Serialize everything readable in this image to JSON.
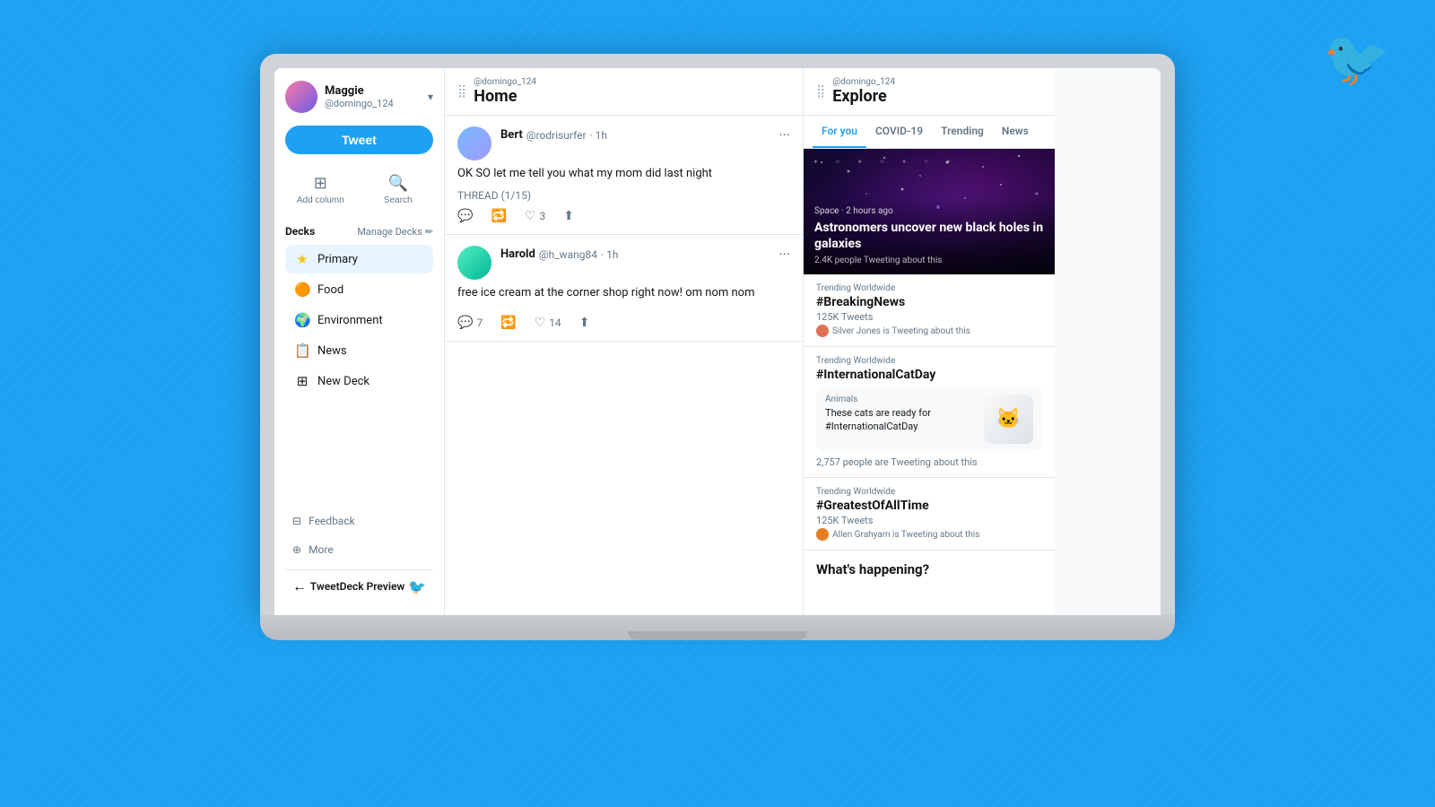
{
  "background": {
    "color": "#1DA1F2"
  },
  "twitter_icon": "🐦",
  "sidebar": {
    "user": {
      "name": "Maggie",
      "handle": "@domingo_124"
    },
    "tweet_button": "Tweet",
    "actions": [
      {
        "id": "add-column",
        "label": "Add column",
        "icon": "⊞"
      },
      {
        "id": "search",
        "label": "Search",
        "icon": "🔍"
      }
    ],
    "decks_title": "Decks",
    "manage_decks": "Manage Decks",
    "decks": [
      {
        "id": "primary",
        "label": "Primary",
        "icon": "★",
        "active": true,
        "color": "#f1c40f"
      },
      {
        "id": "food",
        "label": "Food",
        "icon": "🍊",
        "color": "#e17055"
      },
      {
        "id": "environment",
        "label": "Environment",
        "icon": "🌍",
        "color": "#27ae60"
      },
      {
        "id": "news",
        "label": "News",
        "icon": "📋",
        "color": "#3498db"
      },
      {
        "id": "new-deck",
        "label": "New Deck",
        "icon": "⊞",
        "color": "#95a5a6"
      }
    ],
    "footer": [
      {
        "id": "feedback",
        "label": "Feedback",
        "icon": "⊟"
      },
      {
        "id": "more",
        "label": "More",
        "icon": "⊕"
      }
    ],
    "preview": {
      "text": "TweetDeck Preview",
      "icon": "🐦"
    },
    "back_icon": "←"
  },
  "home_column": {
    "source": "@domingo_124",
    "title": "Home",
    "tweets": [
      {
        "id": "tweet-1",
        "author": "Bert",
        "handle": "@rodrisurfer",
        "time": "1h",
        "text": "OK SO let me tell you what my mom did last night",
        "thread": "THREAD (1/15)",
        "actions": {
          "reply": "",
          "retweet": "",
          "like": "3",
          "share": ""
        }
      },
      {
        "id": "tweet-2",
        "author": "Harold",
        "handle": "@h_wang84",
        "time": "1h",
        "text": "free ice cream at the corner shop right now! om nom nom",
        "has_image": true,
        "actions": {
          "reply": "7",
          "retweet": "",
          "like": "14",
          "share": ""
        }
      }
    ]
  },
  "explore_column": {
    "source": "@domingo_124",
    "title": "Explore",
    "tabs": [
      {
        "id": "for-you",
        "label": "For you",
        "active": true
      },
      {
        "id": "covid-19",
        "label": "COVID-19",
        "active": false
      },
      {
        "id": "trending",
        "label": "Trending",
        "active": false
      },
      {
        "id": "news",
        "label": "News",
        "active": false
      }
    ],
    "news_hero": {
      "category": "Space · 2 hours ago",
      "title": "Astronomers uncover new black holes in galaxies",
      "count": "2.4K people Tweeting about this"
    },
    "trending_items": [
      {
        "id": "breaking-news",
        "meta": "Trending Worldwide",
        "hashtag": "#BreakingNews",
        "count": "125K Tweets",
        "attributed": "Silver Jones is Tweeting about this"
      },
      {
        "id": "cat-day",
        "meta": "Trending Worldwide",
        "hashtag": "#InternationalCatDay",
        "card": {
          "category": "Animals",
          "text": "These cats are ready for #InternationalCatDay"
        },
        "count": "2,757 people are Tweeting about this"
      },
      {
        "id": "greatest",
        "meta": "Trending Worldwide",
        "hashtag": "#GreatestOfAllTime",
        "count": "125K Tweets",
        "attributed": "Allen Grahyam is Tweeting about this"
      }
    ],
    "whats_happening": "What's happening?"
  }
}
